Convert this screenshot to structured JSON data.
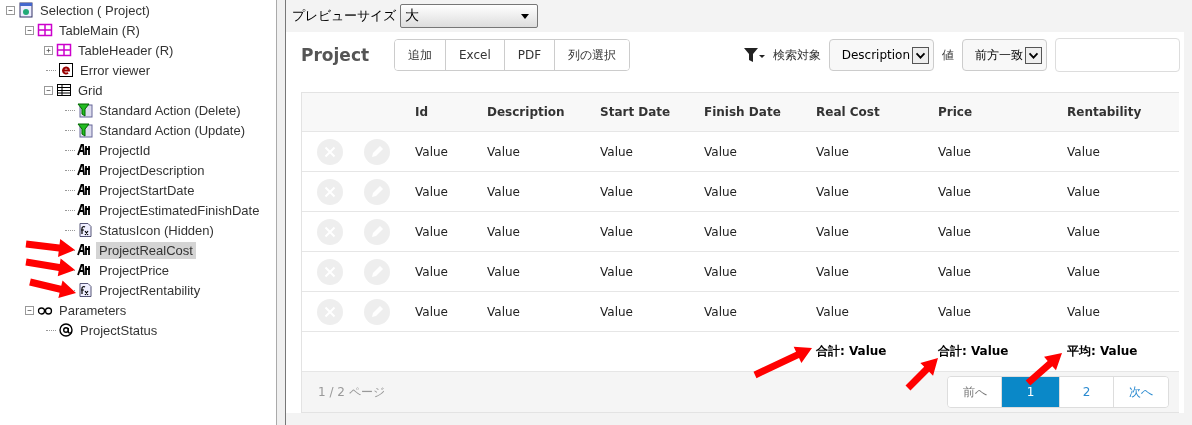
{
  "tree": [
    {
      "label": "Selection ( Project)",
      "kind": "selection",
      "expanded": true,
      "selected": false,
      "children": [
        {
          "label": "TableMain (R)",
          "kind": "table",
          "expanded": true,
          "selected": false,
          "children": [
            {
              "label": "TableHeader (R)",
              "kind": "table",
              "expanded": false,
              "selected": false
            },
            {
              "label": "Error viewer",
              "kind": "error",
              "selected": false
            },
            {
              "label": "Grid",
              "kind": "grid",
              "expanded": true,
              "selected": false,
              "children": [
                {
                  "label": "Standard Action (Delete)",
                  "kind": "action",
                  "selected": false
                },
                {
                  "label": "Standard Action (Update)",
                  "kind": "action",
                  "selected": false
                },
                {
                  "label": "ProjectId",
                  "kind": "attribute",
                  "selected": false
                },
                {
                  "label": "ProjectDescription",
                  "kind": "attribute",
                  "selected": false
                },
                {
                  "label": "ProjectStartDate",
                  "kind": "attribute",
                  "selected": false
                },
                {
                  "label": "ProjectEstimatedFinishDate",
                  "kind": "attribute",
                  "selected": false
                },
                {
                  "label": "StatusIcon (Hidden)",
                  "kind": "variable",
                  "selected": false
                },
                {
                  "label": "ProjectRealCost",
                  "kind": "attribute",
                  "selected": true
                },
                {
                  "label": "ProjectPrice",
                  "kind": "attribute",
                  "selected": false
                },
                {
                  "label": "ProjectRentability",
                  "kind": "variable",
                  "selected": false
                }
              ]
            }
          ]
        },
        {
          "label": "Parameters",
          "kind": "parameters",
          "expanded": true,
          "selected": false,
          "children": [
            {
              "label": "ProjectStatus",
              "kind": "parameter",
              "selected": false
            }
          ]
        }
      ]
    }
  ],
  "preview": {
    "label": "プレビューサイズ",
    "value": "大"
  },
  "title": "Project",
  "toolbar": [
    "追加",
    "Excel",
    "PDF",
    "列の選択"
  ],
  "search": {
    "target_label": "検索対象",
    "target": "Description",
    "value_label": "値",
    "match": "前方一致"
  },
  "table": {
    "columns": [
      {
        "label": "Id"
      },
      {
        "label": "Description"
      },
      {
        "label": "Start Date"
      },
      {
        "label": "Finish Date"
      },
      {
        "label": "Real Cost",
        "total": "合計: Value"
      },
      {
        "label": "Price",
        "total": "合計: Value"
      },
      {
        "label": "Rentability",
        "total": "平均: Value"
      }
    ],
    "rows": [
      [
        "Value",
        "Value",
        "Value",
        "Value",
        "Value",
        "Value",
        "Value"
      ],
      [
        "Value",
        "Value",
        "Value",
        "Value",
        "Value",
        "Value",
        "Value"
      ],
      [
        "Value",
        "Value",
        "Value",
        "Value",
        "Value",
        "Value",
        "Value"
      ],
      [
        "Value",
        "Value",
        "Value",
        "Value",
        "Value",
        "Value",
        "Value"
      ],
      [
        "Value",
        "Value",
        "Value",
        "Value",
        "Value",
        "Value",
        "Value"
      ]
    ]
  },
  "pager": {
    "info": "1 / 2 ページ",
    "buttons": [
      {
        "label": "前へ",
        "selected": false,
        "disabled": true
      },
      {
        "label": "1",
        "selected": true,
        "disabled": false
      },
      {
        "label": "2",
        "selected": false,
        "disabled": false
      },
      {
        "label": "次へ",
        "selected": false,
        "disabled": false
      }
    ]
  }
}
